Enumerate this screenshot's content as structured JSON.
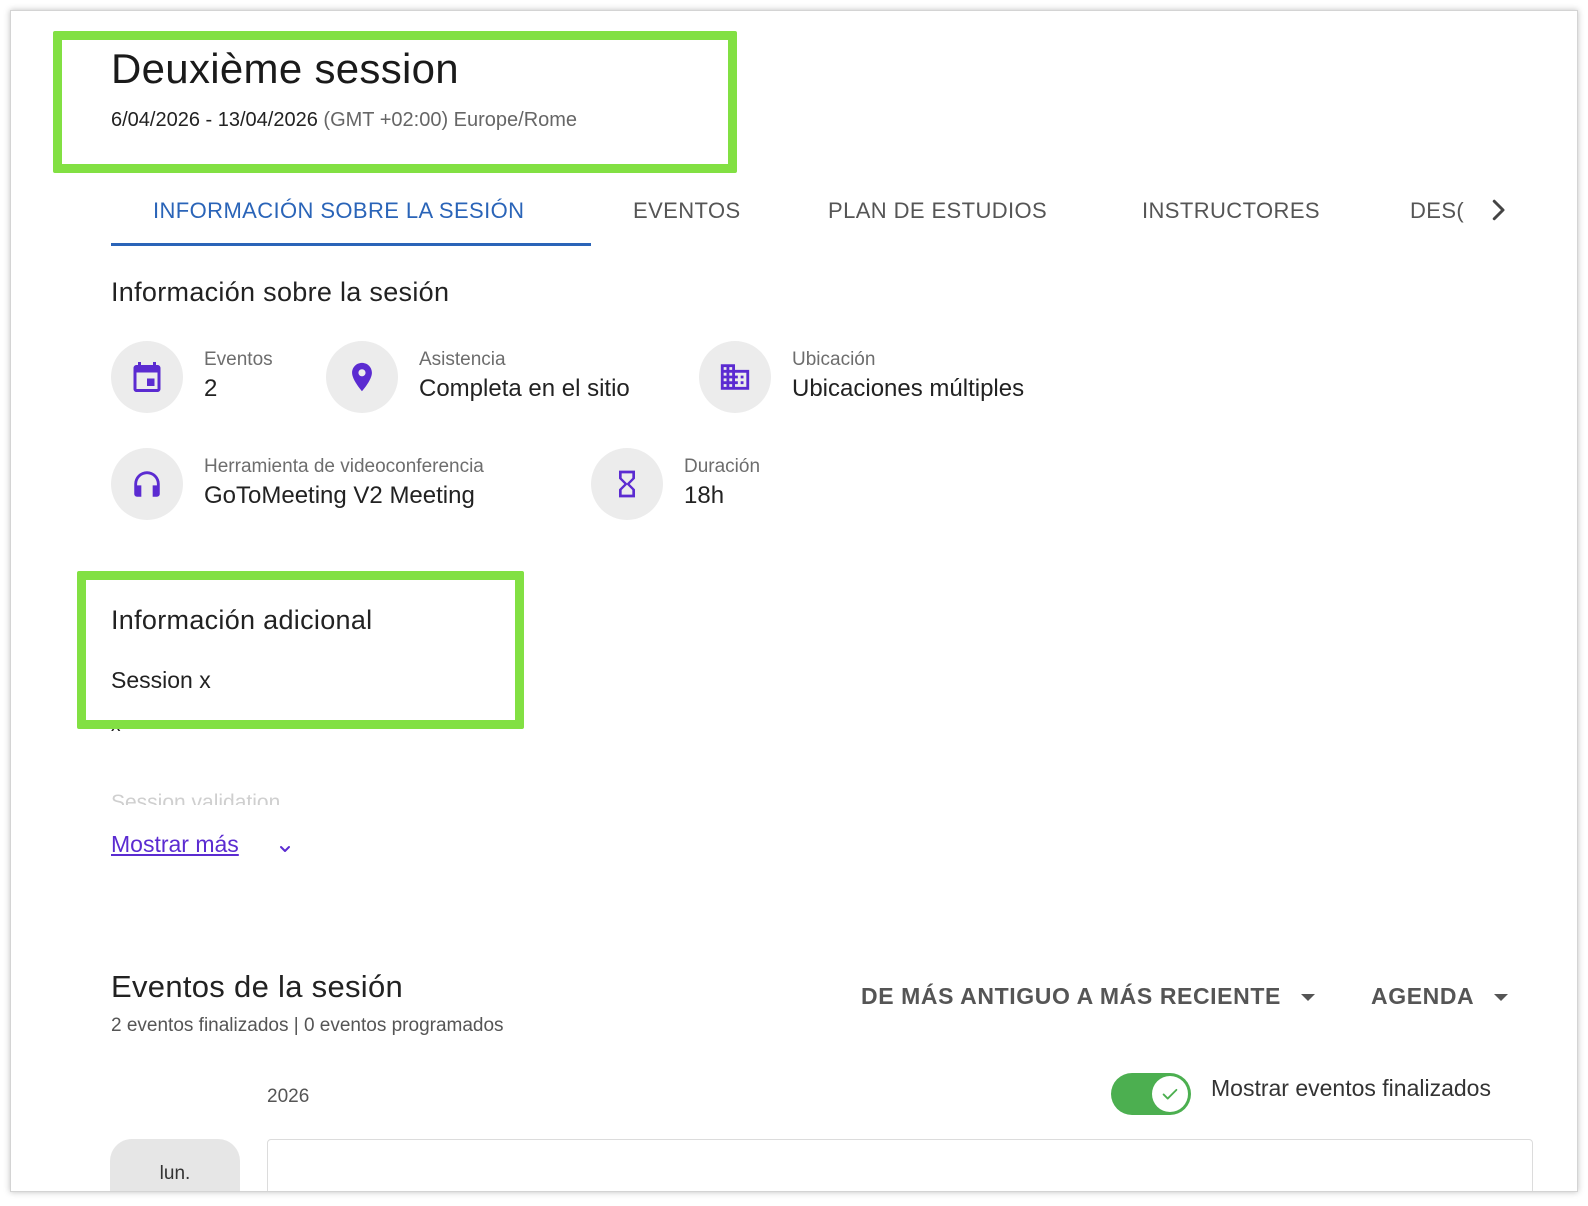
{
  "header": {
    "title": "Deuxième session",
    "date_range": "6/04/2026 - 13/04/2026",
    "timezone": "(GMT +02:00) Europe/Rome"
  },
  "tabs": [
    {
      "label": "INFORMACIÓN SOBRE LA SESIÓN",
      "active": true
    },
    {
      "label": "EVENTOS",
      "active": false
    },
    {
      "label": "PLAN DE ESTUDIOS",
      "active": false
    },
    {
      "label": "INSTRUCTORES",
      "active": false
    },
    {
      "label": "DES(",
      "active": false
    }
  ],
  "session_info": {
    "heading": "Información sobre la sesión",
    "items": [
      {
        "icon": "calendar-icon",
        "label": "Eventos",
        "value": "2"
      },
      {
        "icon": "location-pin-icon",
        "label": "Asistencia",
        "value": "Completa en el sitio"
      },
      {
        "icon": "building-icon",
        "label": "Ubicación",
        "value": "Ubicaciones múltiples"
      },
      {
        "icon": "headphones-icon",
        "label": "Herramienta de videoconferencia",
        "value": "GoToMeeting V2 Meeting"
      },
      {
        "icon": "hourglass-icon",
        "label": "Duración",
        "value": "18h"
      }
    ]
  },
  "additional_info": {
    "heading": "Información adicional",
    "line1": "Session x",
    "line2": "x",
    "line3": "Session validation",
    "show_more": "Mostrar más"
  },
  "events": {
    "heading": "Eventos de la sesión",
    "summary": "2 eventos finalizados | 0 eventos programados",
    "sort_label": "DE MÁS ANTIGUO A MÁS RECIENTE",
    "view_label": "AGENDA",
    "year": "2026",
    "toggle_label": "Mostrar eventos finalizados",
    "toggle_on": true,
    "day": "lun."
  },
  "colors": {
    "accent_tab": "#2a64b8",
    "icon_purple": "#5b2bd1",
    "toggle_green": "#4caf50",
    "highlight_green": "#82e043"
  }
}
